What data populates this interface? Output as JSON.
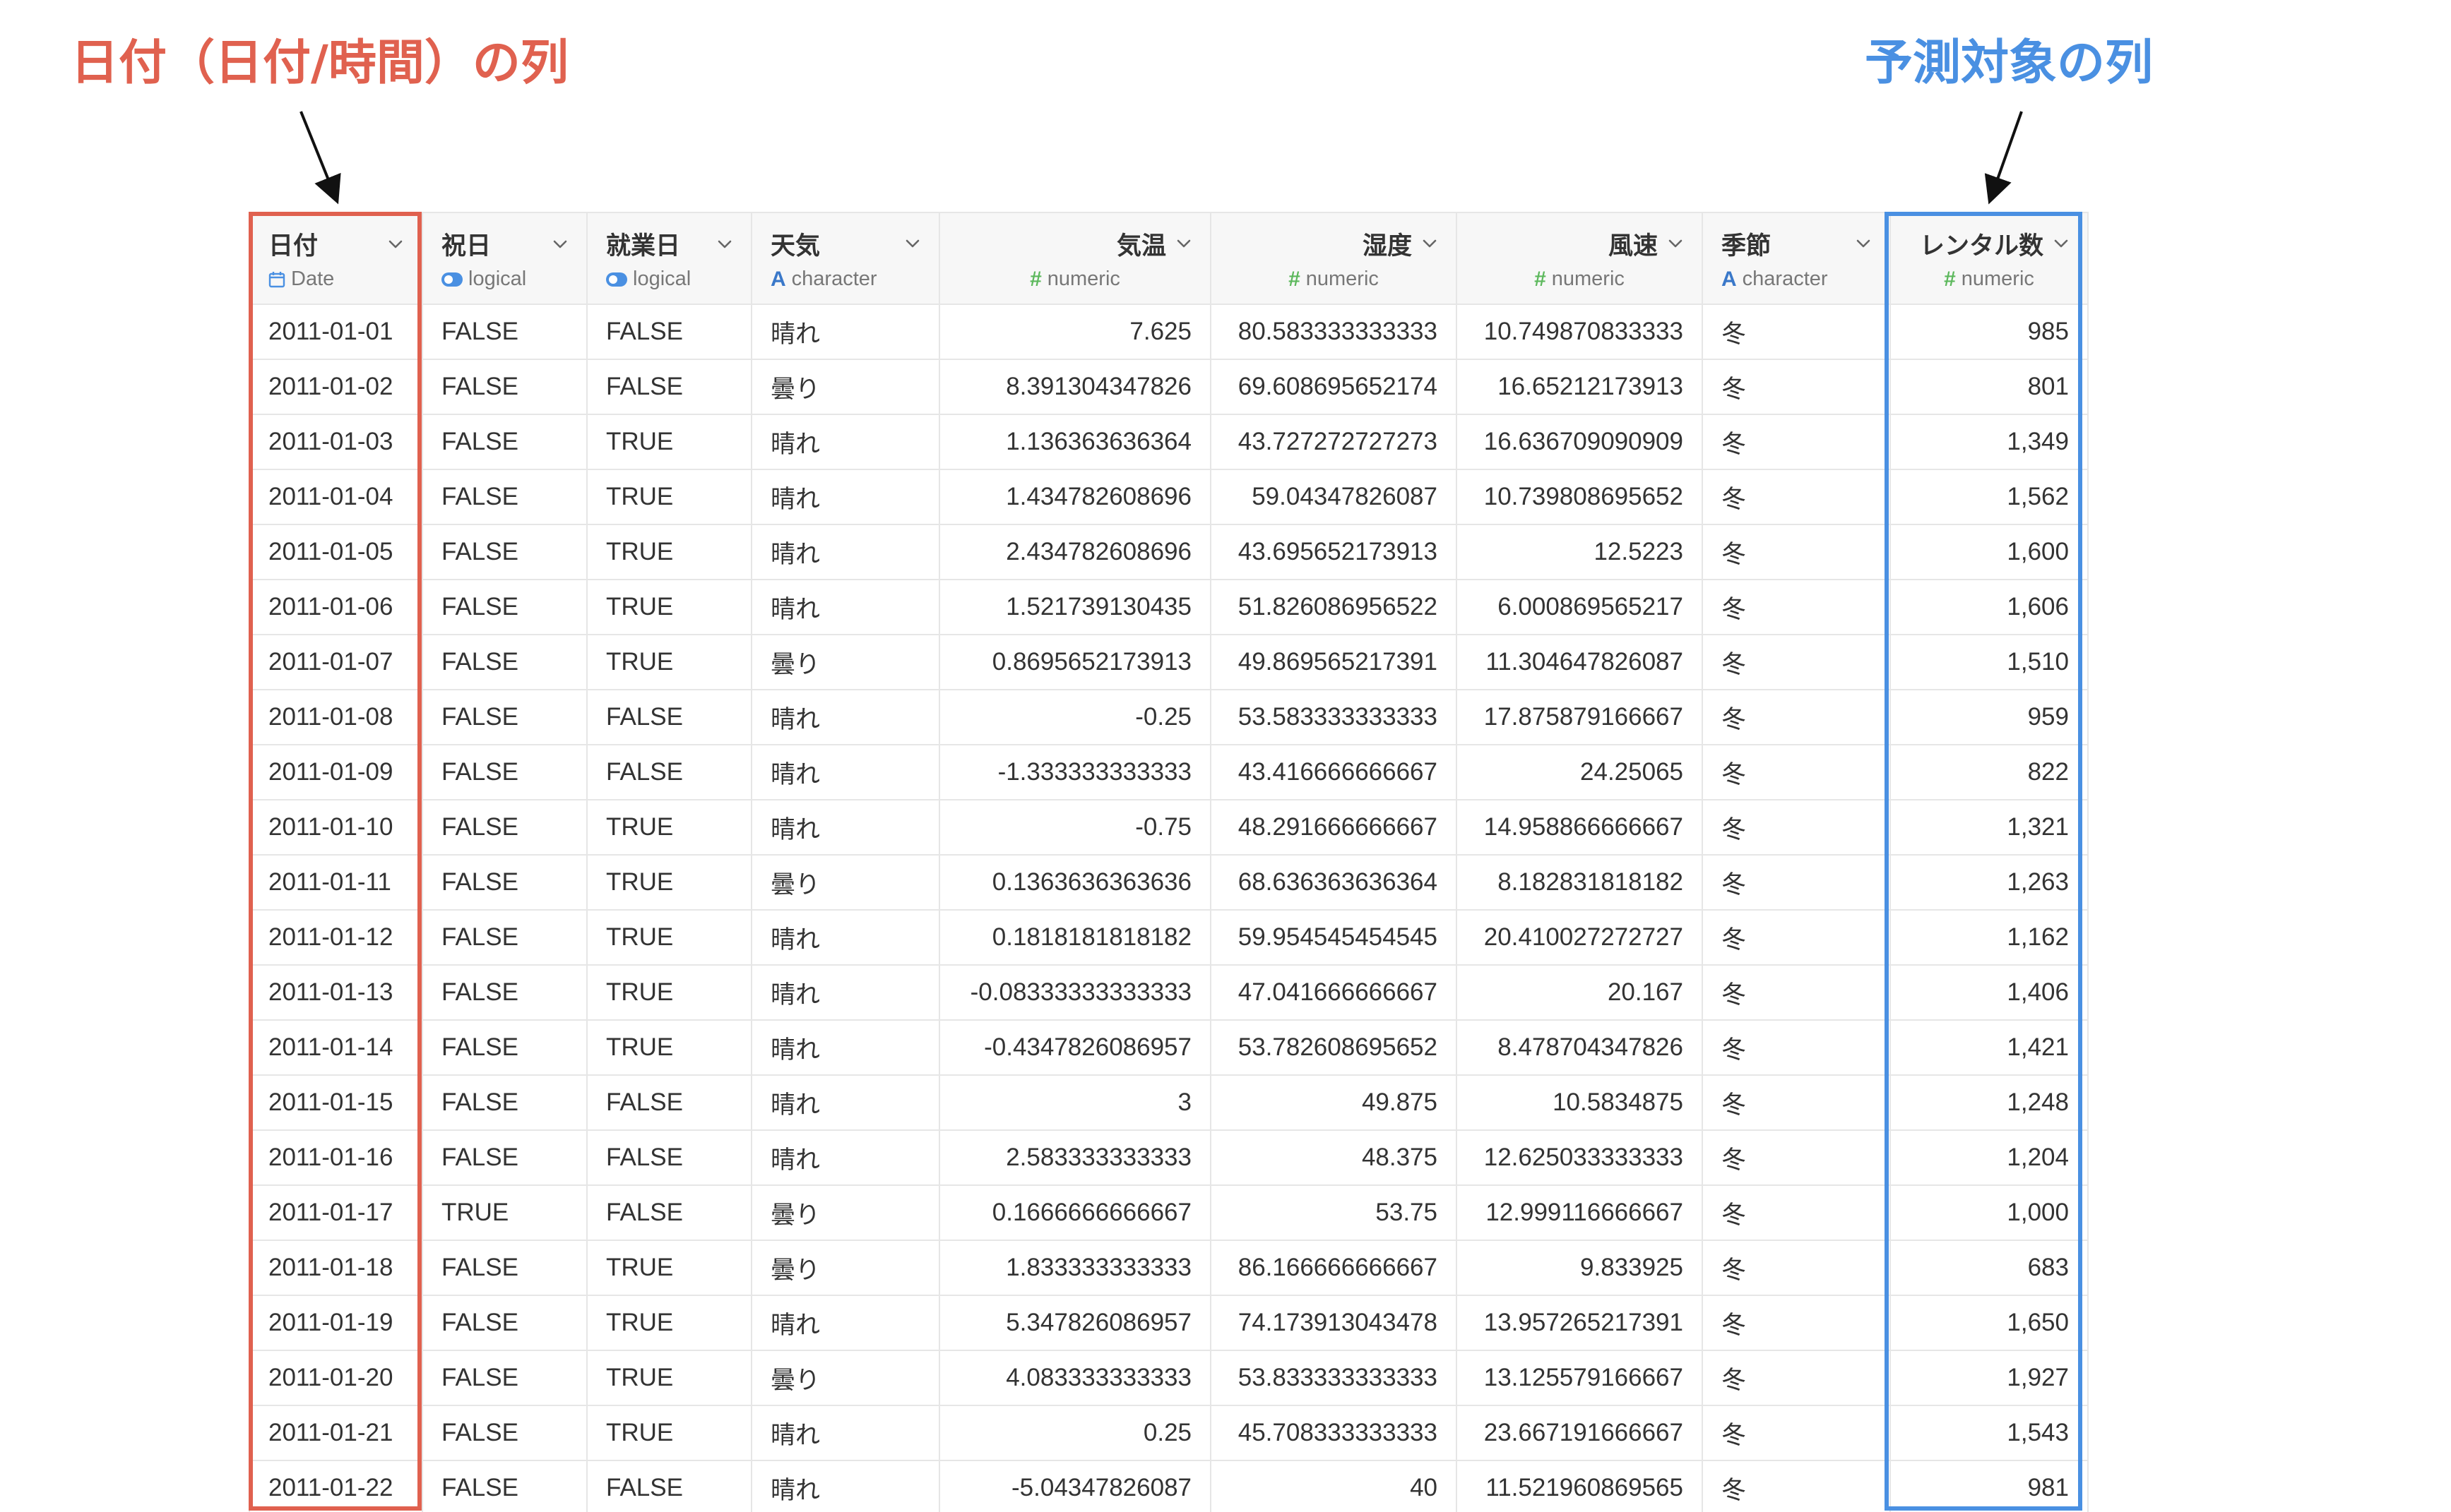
{
  "annotations": {
    "date_column_label": "日付（日付/時間）の列",
    "target_column_label": "予測対象の列"
  },
  "colors": {
    "date_highlight": "#e0614f",
    "target_highlight": "#4a90e2"
  },
  "columns": [
    {
      "name": "日付",
      "type": "Date",
      "type_icon": "calendar-icon"
    },
    {
      "name": "祝日",
      "type": "logical",
      "type_icon": "toggle-icon"
    },
    {
      "name": "就業日",
      "type": "logical",
      "type_icon": "toggle-icon"
    },
    {
      "name": "天気",
      "type": "character",
      "type_icon": "letter-a-icon",
      "icon_glyph": "A"
    },
    {
      "name": "気温",
      "type": "numeric",
      "type_icon": "hash-icon",
      "icon_glyph": "#"
    },
    {
      "name": "湿度",
      "type": "numeric",
      "type_icon": "hash-icon",
      "icon_glyph": "#"
    },
    {
      "name": "風速",
      "type": "numeric",
      "type_icon": "hash-icon",
      "icon_glyph": "#"
    },
    {
      "name": "季節",
      "type": "character",
      "type_icon": "letter-a-icon",
      "icon_glyph": "A"
    },
    {
      "name": "レンタル数",
      "type": "numeric",
      "type_icon": "hash-icon",
      "icon_glyph": "#"
    }
  ],
  "rows": [
    [
      "2011-01-01",
      "FALSE",
      "FALSE",
      "晴れ",
      "7.625",
      "80.583333333333",
      "10.749870833333",
      "冬",
      "985"
    ],
    [
      "2011-01-02",
      "FALSE",
      "FALSE",
      "曇り",
      "8.391304347826",
      "69.608695652174",
      "16.65212173913",
      "冬",
      "801"
    ],
    [
      "2011-01-03",
      "FALSE",
      "TRUE",
      "晴れ",
      "1.136363636364",
      "43.727272727273",
      "16.636709090909",
      "冬",
      "1,349"
    ],
    [
      "2011-01-04",
      "FALSE",
      "TRUE",
      "晴れ",
      "1.434782608696",
      "59.04347826087",
      "10.739808695652",
      "冬",
      "1,562"
    ],
    [
      "2011-01-05",
      "FALSE",
      "TRUE",
      "晴れ",
      "2.434782608696",
      "43.695652173913",
      "12.5223",
      "冬",
      "1,600"
    ],
    [
      "2011-01-06",
      "FALSE",
      "TRUE",
      "晴れ",
      "1.521739130435",
      "51.826086956522",
      "6.000869565217",
      "冬",
      "1,606"
    ],
    [
      "2011-01-07",
      "FALSE",
      "TRUE",
      "曇り",
      "0.8695652173913",
      "49.869565217391",
      "11.304647826087",
      "冬",
      "1,510"
    ],
    [
      "2011-01-08",
      "FALSE",
      "FALSE",
      "晴れ",
      "-0.25",
      "53.583333333333",
      "17.875879166667",
      "冬",
      "959"
    ],
    [
      "2011-01-09",
      "FALSE",
      "FALSE",
      "晴れ",
      "-1.333333333333",
      "43.416666666667",
      "24.25065",
      "冬",
      "822"
    ],
    [
      "2011-01-10",
      "FALSE",
      "TRUE",
      "晴れ",
      "-0.75",
      "48.291666666667",
      "14.958866666667",
      "冬",
      "1,321"
    ],
    [
      "2011-01-11",
      "FALSE",
      "TRUE",
      "曇り",
      "0.1363636363636",
      "68.636363636364",
      "8.182831818182",
      "冬",
      "1,263"
    ],
    [
      "2011-01-12",
      "FALSE",
      "TRUE",
      "晴れ",
      "0.1818181818182",
      "59.954545454545",
      "20.410027272727",
      "冬",
      "1,162"
    ],
    [
      "2011-01-13",
      "FALSE",
      "TRUE",
      "晴れ",
      "-0.08333333333333",
      "47.041666666667",
      "20.167",
      "冬",
      "1,406"
    ],
    [
      "2011-01-14",
      "FALSE",
      "TRUE",
      "晴れ",
      "-0.4347826086957",
      "53.782608695652",
      "8.478704347826",
      "冬",
      "1,421"
    ],
    [
      "2011-01-15",
      "FALSE",
      "FALSE",
      "晴れ",
      "3",
      "49.875",
      "10.5834875",
      "冬",
      "1,248"
    ],
    [
      "2011-01-16",
      "FALSE",
      "FALSE",
      "晴れ",
      "2.583333333333",
      "48.375",
      "12.625033333333",
      "冬",
      "1,204"
    ],
    [
      "2011-01-17",
      "TRUE",
      "FALSE",
      "曇り",
      "0.1666666666667",
      "53.75",
      "12.999116666667",
      "冬",
      "1,000"
    ],
    [
      "2011-01-18",
      "FALSE",
      "TRUE",
      "曇り",
      "1.833333333333",
      "86.166666666667",
      "9.833925",
      "冬",
      "683"
    ],
    [
      "2011-01-19",
      "FALSE",
      "TRUE",
      "晴れ",
      "5.347826086957",
      "74.173913043478",
      "13.957265217391",
      "冬",
      "1,650"
    ],
    [
      "2011-01-20",
      "FALSE",
      "TRUE",
      "曇り",
      "4.083333333333",
      "53.833333333333",
      "13.125579166667",
      "冬",
      "1,927"
    ],
    [
      "2011-01-21",
      "FALSE",
      "TRUE",
      "晴れ",
      "0.25",
      "45.708333333333",
      "23.667191666667",
      "冬",
      "1,543"
    ],
    [
      "2011-01-22",
      "FALSE",
      "FALSE",
      "晴れ",
      "-5.04347826087",
      "40",
      "11.521960869565",
      "冬",
      "981"
    ]
  ]
}
